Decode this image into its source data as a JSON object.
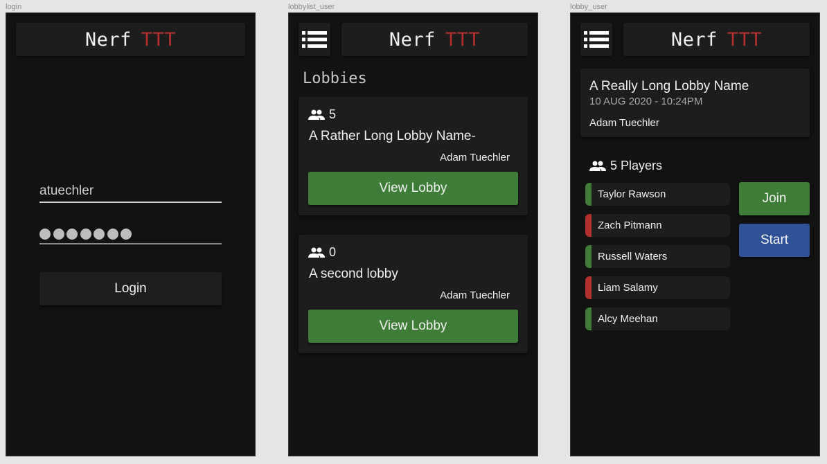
{
  "frames": {
    "login": "login",
    "lobbylist": "lobbylist_user",
    "lobby": "lobby_user"
  },
  "app": {
    "title_part1": "Nerf",
    "title_part2": "TTT"
  },
  "colors": {
    "title_accent": "#b1302d",
    "join_green": "#3e7c37",
    "start_blue": "#2f5196",
    "status_ready": "#3e7c37",
    "status_not_ready": "#b1302d",
    "background": "#121212",
    "card": "#1d1d1d"
  },
  "icons": {
    "menu": "list-menu-icon",
    "people": "group-people-icon"
  },
  "login": {
    "username_value": "atuechler",
    "password_mask_length": 7,
    "login_label": "Login"
  },
  "lobbylist": {
    "heading": "Lobbies",
    "lobbies": [
      {
        "count": "5",
        "name": "A Rather Long Lobby Name-",
        "owner": "Adam Tuechler",
        "button": "View Lobby"
      },
      {
        "count": "0",
        "name": "A second lobby",
        "owner": "Adam Tuechler",
        "button": "View Lobby"
      }
    ]
  },
  "lobby": {
    "name": "A Really Long Lobby Name",
    "date": "10 AUG 2020 - 10:24PM",
    "owner": "Adam Tuechler",
    "players_label": "5 Players",
    "join_label": "Join",
    "start_label": "Start",
    "players": [
      {
        "name": "Taylor Rawson",
        "status": "ready"
      },
      {
        "name": "Zach Pitmann",
        "status": "not_ready"
      },
      {
        "name": "Russell Waters",
        "status": "ready"
      },
      {
        "name": "Liam Salamy",
        "status": "not_ready"
      },
      {
        "name": "Alcy Meehan",
        "status": "ready"
      }
    ]
  }
}
